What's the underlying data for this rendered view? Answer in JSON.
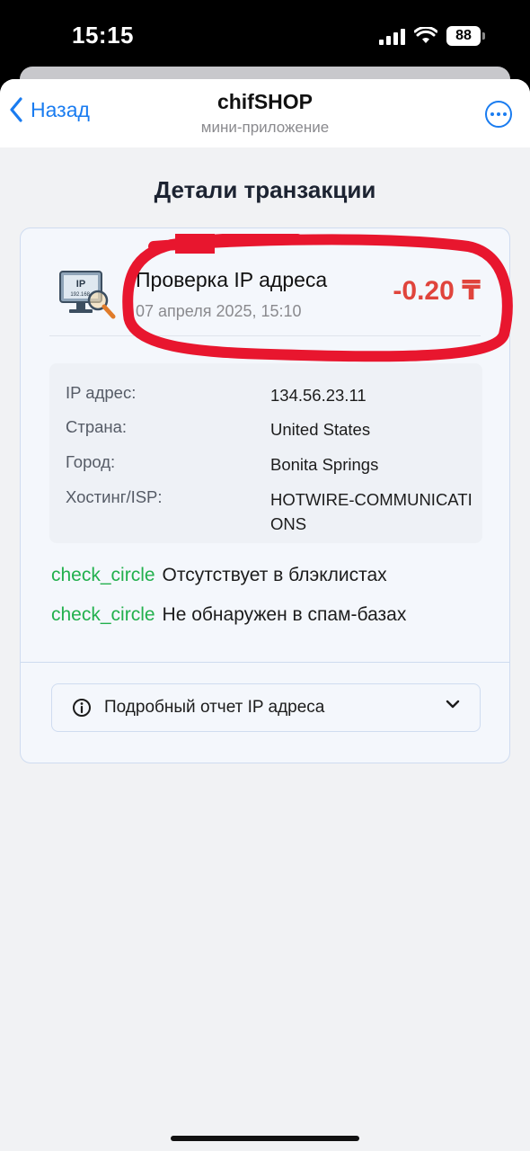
{
  "status_bar": {
    "time": "15:15",
    "battery": "88"
  },
  "nav": {
    "back_label": "Назад",
    "title": "chifSHOP",
    "subtitle": "мини-приложение"
  },
  "page": {
    "title": "Детали транзакции"
  },
  "transaction": {
    "name": "Проверка IP адреса",
    "date": "07 апреля 2025, 15:10",
    "amount": "-0.20 ₸",
    "icon_text": "IP",
    "icon_subtext": "192.168."
  },
  "details": [
    {
      "label": "IP адрес:",
      "value": "134.56.23.11"
    },
    {
      "label": "Страна:",
      "value": "United States"
    },
    {
      "label": "Город:",
      "value": "Bonita Springs"
    },
    {
      "label": "Хостинг/ISP:",
      "value": "HOTWIRE-COMMUNICATIONS"
    }
  ],
  "checks": [
    {
      "icon": "check_circle",
      "text": "Отсутствует в блэклистах"
    },
    {
      "icon": "check_circle",
      "text": "Не обнаружен в спам-базах"
    }
  ],
  "report_button": {
    "label": "Подробный отчет IP адреса"
  },
  "colors": {
    "accent": "#1a7cf0",
    "amount": "#e0443c",
    "check": "#22b04d",
    "annotation": "#e8162e"
  }
}
